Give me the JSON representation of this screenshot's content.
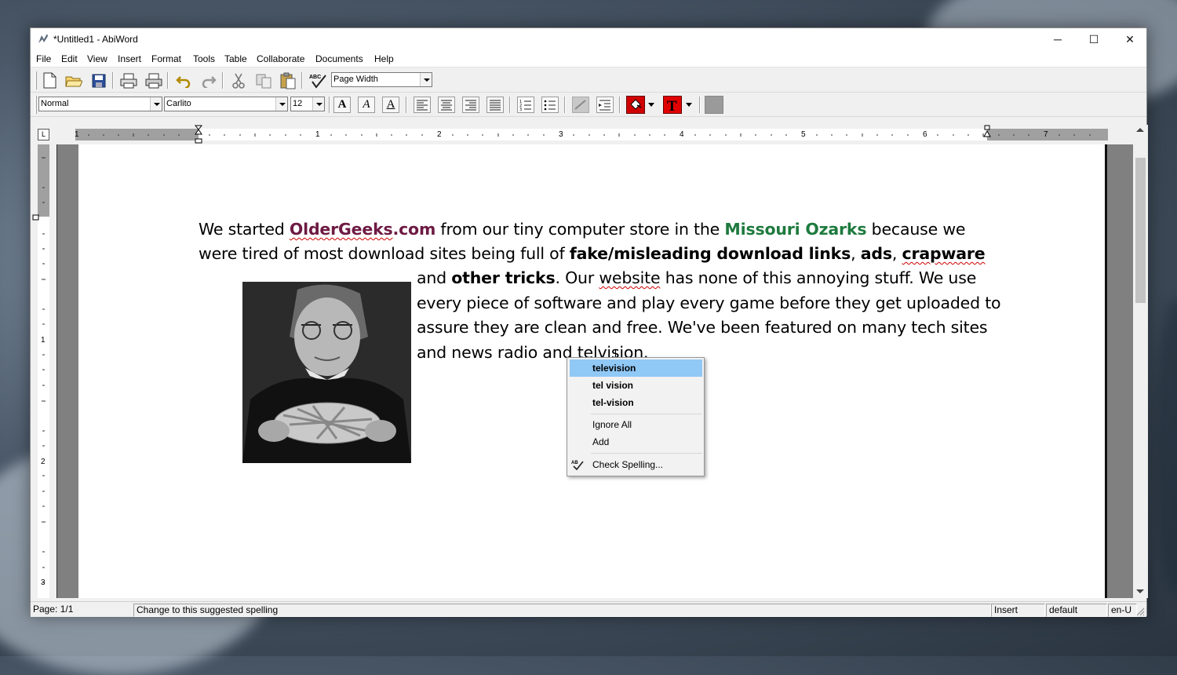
{
  "window": {
    "title": "*Untitled1 - AbiWord",
    "controls": {
      "minimize": "─",
      "maximize": "☐",
      "close": "✕"
    }
  },
  "menubar": [
    "File",
    "Edit",
    "View",
    "Insert",
    "Format",
    "Tools",
    "Table",
    "Collaborate",
    "Documents",
    "Help"
  ],
  "toolbar": {
    "zoom_value": "Page Width",
    "style_value": "Normal",
    "font_value": "Carlito",
    "size_value": "12",
    "spell_label": "ABC",
    "bold_glyph": "A",
    "italic_glyph": "A",
    "underline_glyph": "A",
    "text_color_glyph": "T",
    "highlight_color": "#d00000",
    "text_color": "#e00000"
  },
  "ruler": {
    "corner_label": "L",
    "horizontal_numbers": [
      "1",
      "1",
      "2",
      "3",
      "4",
      "5",
      "6",
      "7"
    ],
    "vertical_numbers": [
      "1",
      "2",
      "3"
    ]
  },
  "document": {
    "line1": {
      "a": "We started ",
      "link": "OlderGeeks",
      "link_tail": ".com",
      "b": " from our tiny computer store in the ",
      "place": "Missouri Ozarks",
      "c": " because we"
    },
    "line2": {
      "a": "were tired of most download sites being full of ",
      "bold1": "fake/misleading download links",
      "sep1": ", ",
      "bold2": "ads",
      "sep2": ", ",
      "bold3": "crapware"
    },
    "line3": {
      "a": "and ",
      "bold": "other tricks",
      "b": ". Our ",
      "misspelled": "website",
      "c": " has none of this annoying stuff. We use"
    },
    "line4": "every piece of software and play every game before they get uploaded to",
    "line5": "assure they are clean and free. We've been featured on many tech sites",
    "line6": {
      "a": "and news radio and ",
      "misspelled": "telvision",
      "b": "."
    },
    "image_alt": "photo of elderly woman holding a lattice pie"
  },
  "context_menu": {
    "suggestions": [
      "television",
      "tel vision",
      "tel-vision"
    ],
    "ignore_all": "Ignore All",
    "add": "Add",
    "check_spelling": "Check Spelling..."
  },
  "statusbar": {
    "page": "Page: 1/1",
    "message": "Change to this suggested spelling",
    "mode": "Insert",
    "style": "default",
    "language": "en-U"
  }
}
